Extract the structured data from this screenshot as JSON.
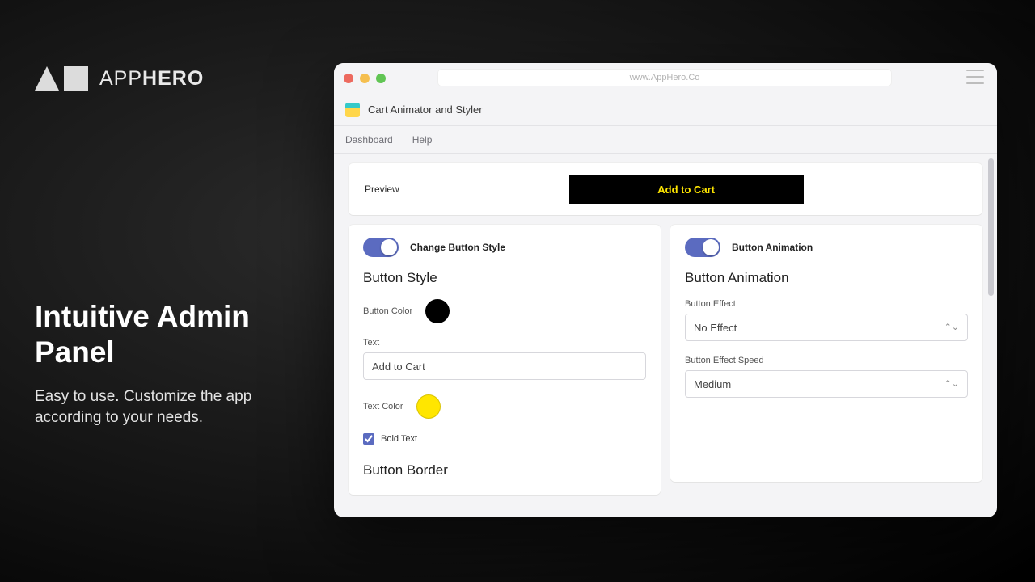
{
  "promo": {
    "brand_prefix": "APP",
    "brand_bold": "HERO",
    "headline": "Intuitive Admin Panel",
    "sub": "Easy to use. Customize the app according to your needs."
  },
  "browser": {
    "url": "www.AppHero.Co"
  },
  "app": {
    "title": "Cart Animator and Styler",
    "nav": {
      "dashboard": "Dashboard",
      "help": "Help"
    }
  },
  "preview": {
    "label": "Preview",
    "button_text": "Add to Cart",
    "button_bg": "#000000",
    "button_fg": "#ffe600"
  },
  "left_panel": {
    "toggle_label": "Change Button Style",
    "section": "Button Style",
    "button_color_label": "Button Color",
    "button_color": "#000000",
    "text_label": "Text",
    "text_value": "Add to Cart",
    "text_color_label": "Text Color",
    "text_color": "#ffe600",
    "bold_label": "Bold Text",
    "border_section": "Button Border"
  },
  "right_panel": {
    "toggle_label": "Button Animation",
    "section": "Button Animation",
    "effect_label": "Button Effect",
    "effect_value": "No Effect",
    "speed_label": "Button Effect Speed",
    "speed_value": "Medium"
  }
}
